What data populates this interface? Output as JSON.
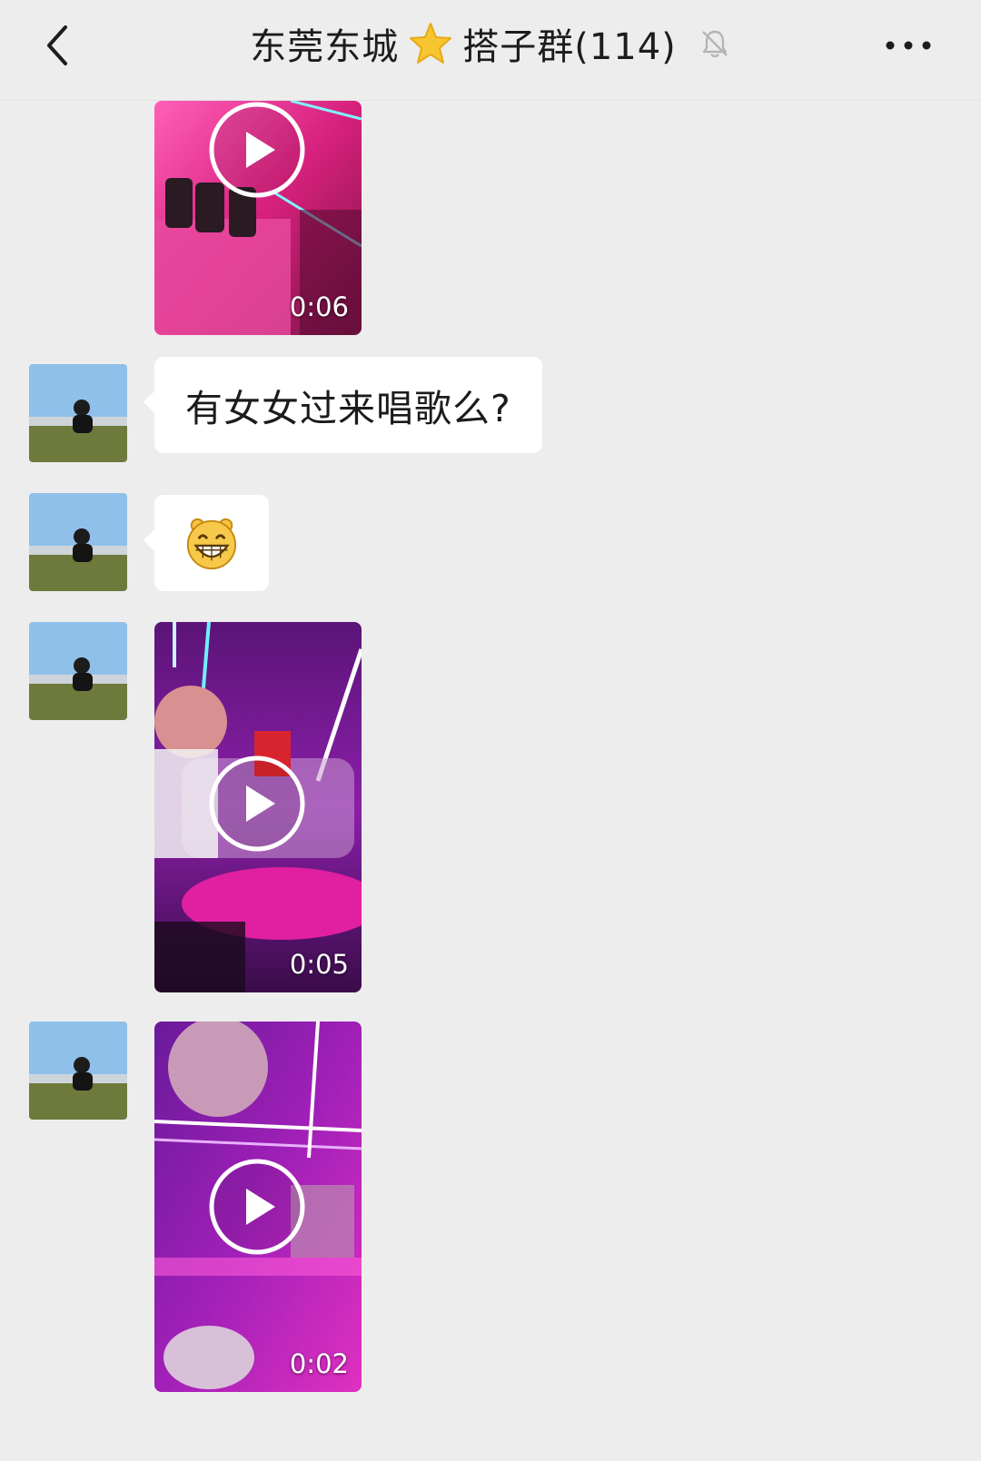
{
  "header": {
    "title_part1": "东莞东城",
    "title_part2": "搭子群(114)",
    "icons": [
      "back-icon",
      "star-icon",
      "mute-bell-icon",
      "more-icon"
    ]
  },
  "messages": [
    {
      "type": "video",
      "duration": "0:06"
    },
    {
      "type": "text",
      "text": "有女女过来唱歌么?"
    },
    {
      "type": "emoji",
      "emoji": "grinning-face-icon"
    },
    {
      "type": "video",
      "duration": "0:05"
    },
    {
      "type": "video",
      "duration": "0:02"
    }
  ],
  "colors": {
    "background": "#ededed",
    "bubble": "#ffffff",
    "video_pink": "#e0308a",
    "video_purple": "#6a1a8a"
  }
}
